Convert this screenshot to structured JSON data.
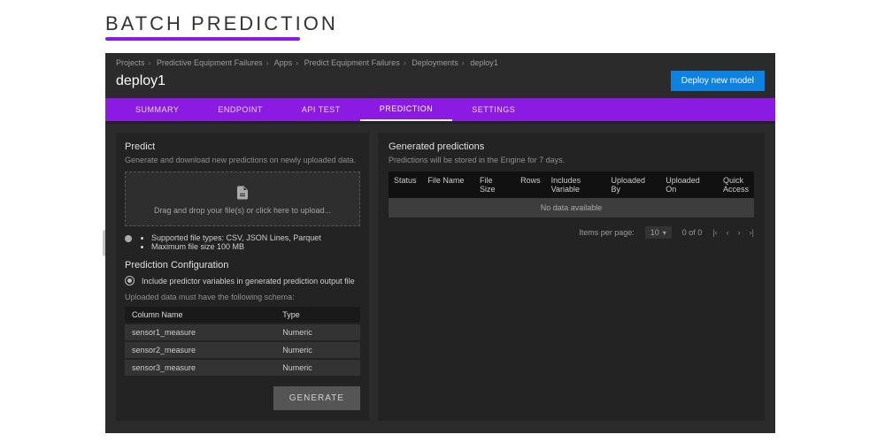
{
  "page": {
    "title": "BATCH PREDICTION"
  },
  "breadcrumbs": {
    "items": [
      "Projects",
      "Predictive Equipment Failures",
      "Apps",
      "Predict Equipment Failures",
      "Deployments",
      "deploy1"
    ]
  },
  "header": {
    "name": "deploy1",
    "deploy_button": "Deploy new model"
  },
  "tabs": {
    "items": [
      {
        "label": "SUMMARY",
        "active": false
      },
      {
        "label": "ENDPOINT",
        "active": false
      },
      {
        "label": "API TEST",
        "active": false
      },
      {
        "label": "PREDICTION",
        "active": true
      },
      {
        "label": "SETTINGS",
        "active": false
      }
    ]
  },
  "predict": {
    "title": "Predict",
    "subtext": "Generate and download new predictions on newly uploaded data.",
    "drop_label": "Drag and drop your file(s) or click here to upload...",
    "hints": [
      "Supported file types: CSV, JSON Lines, Parquet",
      "Maximum file size 100 MB"
    ],
    "config": {
      "title": "Prediction Configuration",
      "option_label": "Include predictor variables in generated prediction output file",
      "schema_note": "Uploaded data must have the following schema:",
      "schema_headers": {
        "col": "Column Name",
        "type": "Type"
      },
      "schema": [
        {
          "col": "sensor1_measure",
          "type": "Numeric"
        },
        {
          "col": "sensor2_measure",
          "type": "Numeric"
        },
        {
          "col": "sensor3_measure",
          "type": "Numeric"
        }
      ],
      "generate_label": "GENERATE"
    }
  },
  "generated": {
    "title": "Generated predictions",
    "subtext": "Predictions will be stored in the Engine for 7 days.",
    "columns": {
      "status": "Status",
      "fname": "File Name",
      "fsize": "File Size",
      "rows": "Rows",
      "incl": "Includes Variable",
      "upby": "Uploaded By",
      "upon": "Uploaded On",
      "qa": "Quick Access"
    },
    "empty_text": "No data available",
    "pager": {
      "per_page_label": "Items per page:",
      "per_page_value": "10",
      "range": "0 of 0"
    }
  }
}
